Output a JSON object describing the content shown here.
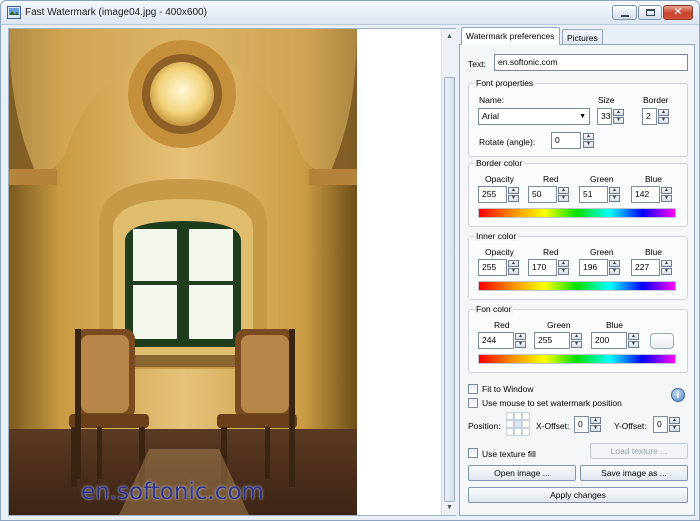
{
  "window": {
    "title": "Fast Watermark (image04.jpg - 400x600)"
  },
  "viewer": {
    "watermark_text": "en.softonic.com"
  },
  "tabs": [
    {
      "label": "Watermark preferences"
    },
    {
      "label": "Pictures"
    }
  ],
  "prefs": {
    "text_label": "Text:",
    "text_value": "en.softonic.com",
    "font": {
      "title": "Font properties",
      "name_label": "Name:",
      "name_value": "Arial",
      "size_label": "Size",
      "size_value": "33",
      "border_label": "Border",
      "border_value": "2",
      "rotate_label": "Rotate (angle):",
      "rotate_value": "0"
    },
    "border_color": {
      "title": "Border color",
      "labels": [
        "Opacity",
        "Red",
        "Green",
        "Blue"
      ],
      "values": [
        "255",
        "50",
        "51",
        "142"
      ]
    },
    "inner_color": {
      "title": "Inner color",
      "labels": [
        "Opacity",
        "Red",
        "Green",
        "Blue"
      ],
      "values": [
        "255",
        "170",
        "196",
        "227"
      ]
    },
    "fon_color": {
      "title": "Fon color",
      "labels": [
        "Red",
        "Green",
        "Blue"
      ],
      "values": [
        "244",
        "255",
        "200"
      ]
    },
    "fit_to_window": "Fit to Window",
    "use_mouse": "Use mouse to set watermark position",
    "position_label": "Position:",
    "x_offset_label": "X-Offset:",
    "x_offset_value": "0",
    "y_offset_label": "Y-Offset:",
    "y_offset_value": "0",
    "use_texture": "Use texture fill",
    "load_texture": "Load texture ...",
    "open_image": "Open image ...",
    "save_image": "Save image as ...",
    "apply_changes": "Apply changes"
  },
  "colors": {
    "watermark_fill": "#3233 8e",
    "accent": "#4f80bd"
  }
}
